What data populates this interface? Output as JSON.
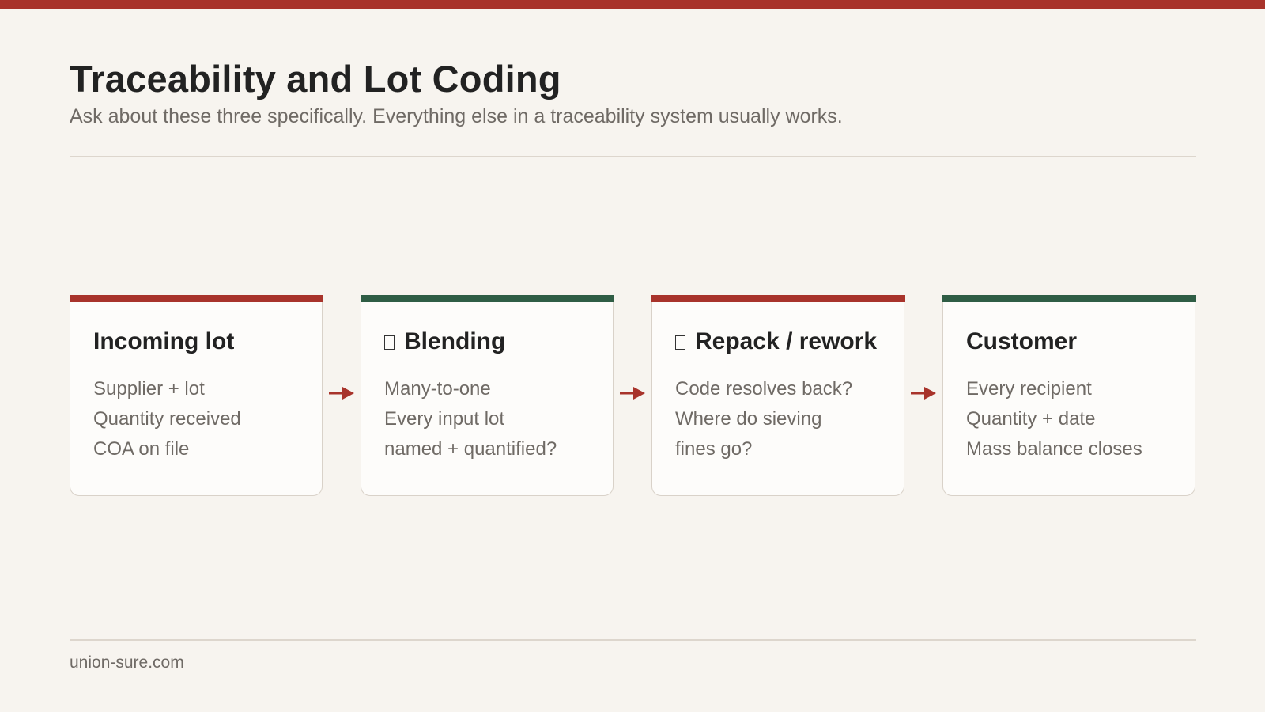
{
  "slide": {
    "title": "Traceability and Lot Coding",
    "subtitle": "Ask about these three specifically. Everything else in a traceability system usually works.",
    "footer": "union-sure.com"
  },
  "colors": {
    "accent_red": "#a8332b",
    "accent_green": "#2f5d45",
    "background": "#f7f4ef"
  },
  "flow": {
    "steps": [
      {
        "title": "Incoming lot",
        "accent": "red",
        "icon": "",
        "lines": [
          "Supplier + lot",
          "Quantity received",
          "COA on file"
        ]
      },
      {
        "title": "Blending",
        "accent": "green",
        "icon": "box-glyph-icon",
        "lines": [
          "Many-to-one",
          "Every input lot",
          "named + quantified?"
        ]
      },
      {
        "title": "Repack / rework",
        "accent": "red",
        "icon": "box-glyph-icon",
        "lines": [
          "Code resolves back?",
          "Where do sieving",
          "fines go?"
        ]
      },
      {
        "title": "Customer",
        "accent": "green",
        "icon": "",
        "lines": [
          "Every recipient",
          "Quantity + date",
          "Mass balance closes"
        ]
      }
    ],
    "connector_icon": "arrow-right-icon"
  }
}
